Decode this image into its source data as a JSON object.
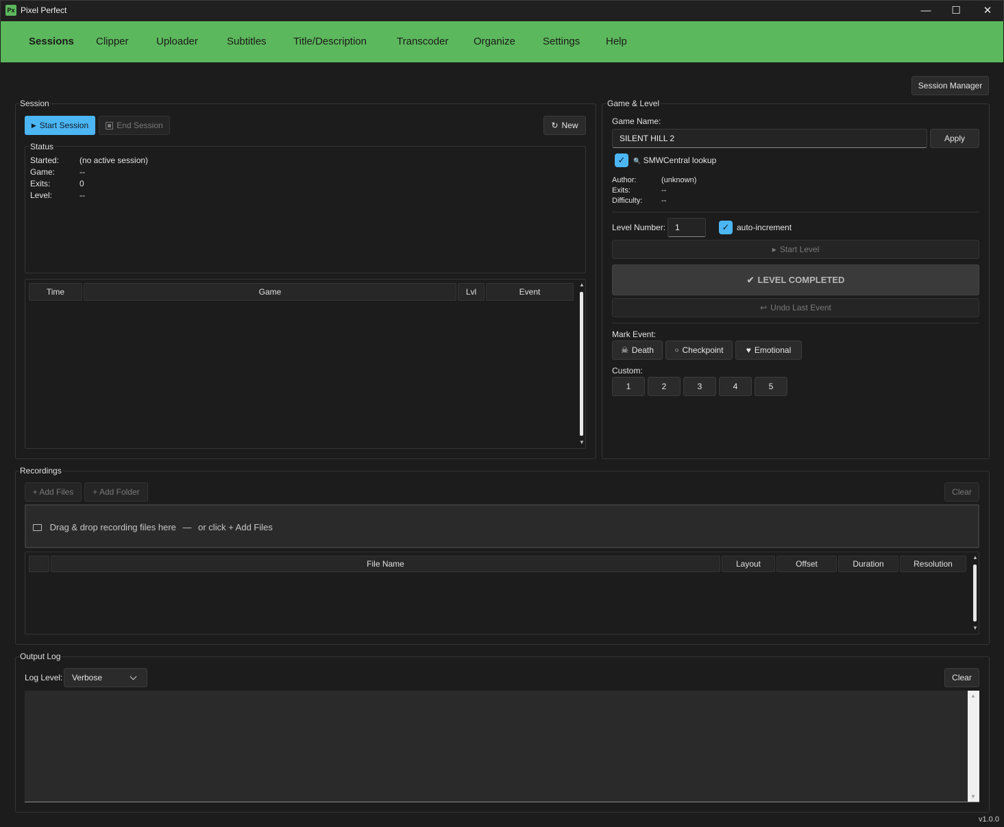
{
  "window": {
    "app_icon_text": "Px",
    "title": "Pixel Perfect",
    "minimize": "—",
    "maximize": "☐",
    "close": "✕"
  },
  "nav": {
    "tabs": [
      "Sessions",
      "Clipper",
      "Uploader",
      "Subtitles",
      "Title/Description",
      "Transcoder",
      "Organize",
      "Settings",
      "Help"
    ],
    "active": "Sessions"
  },
  "toolbar": {
    "session_manager": "Session Manager"
  },
  "session": {
    "title": "Session",
    "start_button": "Start Session",
    "end_button": "End Session",
    "new_button": "New",
    "status": {
      "title": "Status",
      "started_label": "Started:",
      "started_value": "(no active session)",
      "game_label": "Game:",
      "game_value": "--",
      "exits_label": "Exits:",
      "exits_value": "0",
      "level_label": "Level:",
      "level_value": "--"
    },
    "table": {
      "columns": [
        "Time",
        "Game",
        "Lvl",
        "Event"
      ],
      "rows": []
    }
  },
  "game_level": {
    "title": "Game & Level",
    "game_name_label": "Game Name:",
    "game_name_value": "SILENT HILL 2",
    "apply_button": "Apply",
    "smw_lookup_label": "SMWCentral lookup",
    "smw_lookup_checked": true,
    "author_label": "Author:",
    "author_value": "(unknown)",
    "exits_label": "Exits:",
    "exits_value": "--",
    "difficulty_label": "Difficulty:",
    "difficulty_value": "--",
    "level_number_label": "Level Number:",
    "level_number_value": "1",
    "auto_increment_label": "auto-increment",
    "auto_increment_checked": true,
    "start_level_button": "Start Level",
    "level_completed_button": "LEVEL COMPLETED",
    "undo_button": "Undo Last Event",
    "mark_event_label": "Mark Event:",
    "mark_events": [
      "Death",
      "Checkpoint",
      "Emotional"
    ],
    "custom_label": "Custom:",
    "custom_buttons": [
      "1",
      "2",
      "3",
      "4",
      "5"
    ]
  },
  "recordings": {
    "title": "Recordings",
    "add_files": "+ Add Files",
    "add_folder": "+ Add Folder",
    "clear": "Clear",
    "drop_text": "Drag & drop recording files here",
    "drop_sep": "—",
    "drop_alt": "or click + Add Files",
    "table": {
      "columns": [
        "",
        "File Name",
        "Layout",
        "Offset",
        "Duration",
        "Resolution"
      ],
      "rows": []
    }
  },
  "output_log": {
    "title": "Output Log",
    "log_level_label": "Log Level:",
    "log_level_value": "Verbose",
    "clear": "Clear"
  },
  "version": "v1.0.0",
  "colors": {
    "accent": "#5cb85c",
    "primary_button": "#4cb6f5",
    "background": "#1c1c1c"
  }
}
